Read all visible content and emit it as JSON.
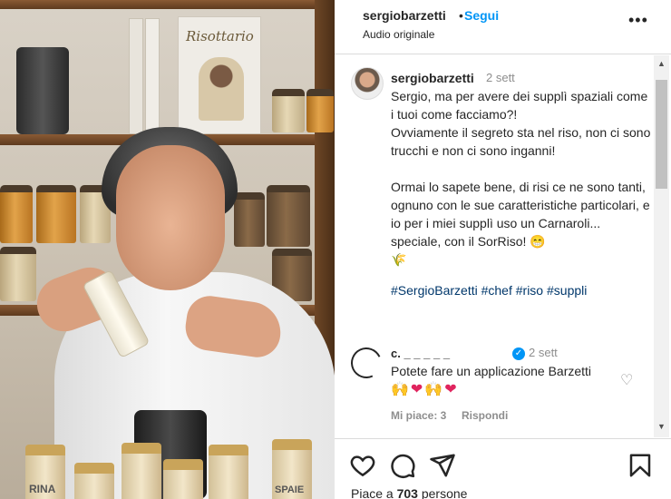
{
  "post": {
    "header": {
      "username": "sergiobarzetti",
      "separator": "•",
      "follow_label": "Segui",
      "audio": "Audio originale",
      "more_label": "•••"
    },
    "caption": {
      "username": "sergiobarzetti",
      "time": "2 sett",
      "text": "Sergio, ma per avere dei supplì spaziali come i tuoi come facciamo?!\nOvviamente il segreto sta nel riso, non ci sono trucchi e non ci sono inganni!\n\nOrmai lo sapete bene, di risi ce ne sono tanti, ognuno con le sue caratteristiche particolari, e io per i miei supplì uso un Carnaroli... speciale, con il SorRiso! 😁\n🌾",
      "hashtags": [
        "#SergioBarzetti",
        "#chef",
        "#riso",
        "#suppli"
      ]
    },
    "comments": [
      {
        "username": "c.  _  _  _  _  _",
        "time": "2 sett",
        "text": "Potete fare un applicazione Barzetti",
        "emojis": "🙌❤🙌❤",
        "likes": "Mi piace: 3",
        "reply_label": "Rispondi"
      }
    ],
    "likes_prefix": "Piace a ",
    "likes_count": "703",
    "likes_suffix": " persone"
  },
  "media": {
    "book_title": "Risottario",
    "table_jar_labels": [
      "RINA",
      "SPAIE"
    ]
  },
  "icons": [
    "heart-icon",
    "comment-icon",
    "share-icon",
    "bookmark-icon",
    "verified-icon",
    "more-icon"
  ],
  "colors": {
    "link": "#0095f6",
    "hashtag": "#00376b",
    "muted": "#8e8e8e"
  }
}
